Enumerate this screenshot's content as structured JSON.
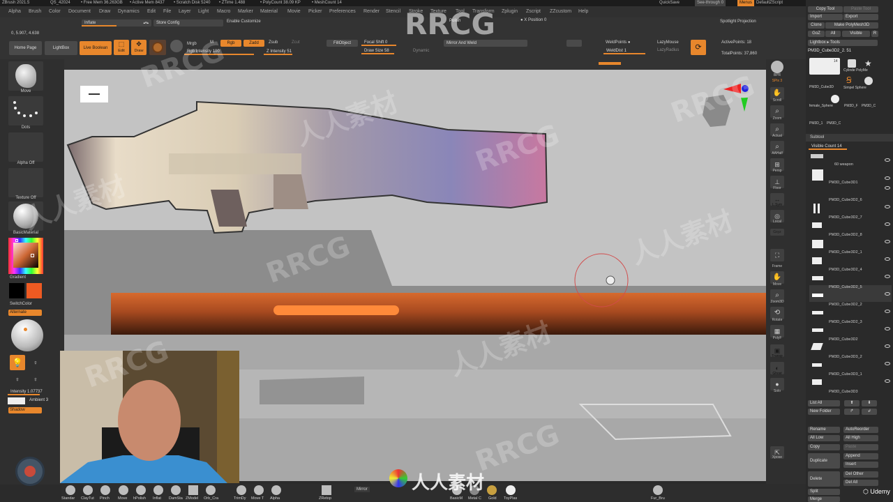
{
  "titlebar": {
    "app": "ZBrush 2021.5",
    "qs": "QS_42024",
    "free_mem": "• Free Mem 36.263GB",
    "active_mem": "• Active Mem 8437",
    "scratch": "• Scratch Disk 5240",
    "ztime": "• ZTime 1.488",
    "polycount": "• PolyCount 38.09 KP",
    "meshcount": "• MeshCount 14",
    "quicksave": "QuickSave",
    "seethrough": "See-through",
    "seethrough_val": "0",
    "menus": "Menus",
    "script": "DefaultZScript"
  },
  "menu": [
    "Alpha",
    "Brush",
    "Color",
    "Document",
    "Draw",
    "Dynamics",
    "Edit",
    "File",
    "Layer",
    "Light",
    "Macro",
    "Marker",
    "Material",
    "Movie",
    "Picker",
    "Preferences",
    "Render",
    "Stencil",
    "Stroke",
    "Texture",
    "Tool",
    "Transform",
    "Zplugin",
    "Zscript",
    "ZZcustom",
    "Help"
  ],
  "topbar": {
    "inflate": "Inflate",
    "store_config": "Store Config",
    "enable_customize": "Enable Customize",
    "coords": "0, 5.907, 4.638",
    "home": "Home Page",
    "lightbox": "LightBox",
    "live_boolean": "Live Boolean",
    "edit": "Edit",
    "draw": "Draw",
    "mrgb": "Mrgb",
    "m": "M",
    "rgb": "Rgb",
    "zadd": "Zadd",
    "zsub": "Zsub",
    "zcut": "Zcut",
    "rgb_intensity": "Rgb Intensity",
    "rgb_intensity_val": "100",
    "z_intensity": "Z Intensity",
    "z_intensity_val": "51",
    "fill_object": "FillObject",
    "focal_shift": "Focal Shift",
    "focal_shift_val": "0",
    "draw_size": "Draw Size",
    "draw_size_val": "58",
    "dynamic": "Dynamic",
    "polish": "Polish",
    "x_position": "X Position",
    "x_position_val": "0",
    "mirror_and_weld": "Mirror And Weld",
    "weld_points": "WeldPoints",
    "weld_dist": "WeldDist",
    "weld_dist_val": "1",
    "lazymouse": "LazyMouse",
    "lazyradius": "LazyRadius",
    "spotlight": "Spotlight Projection",
    "active_points": "ActivePoints: 18",
    "total_points": "TotalPoints: 37,860"
  },
  "leftshelf": {
    "move": "Move",
    "dots": "Dots",
    "alpha_off": "Alpha Off",
    "texture_off": "Texture Off",
    "basic_material": "BasicMaterial",
    "gradient": "Gradient",
    "switch_color": "SwitchColor",
    "alternate": "Alternate",
    "intensity": "Intensity",
    "intensity_val": "1.07737",
    "ambient": "Ambient",
    "ambient_val": "3",
    "shadow": "Shadow"
  },
  "rightshelf": [
    "BPR",
    "SPix 3",
    "Scroll",
    "Zoom",
    "Actual",
    "AAHalf",
    "Persp",
    "Floor",
    "L.Sym",
    "Local",
    "Gxyz",
    "Frame",
    "Move",
    "Zoom3D",
    "Rotate",
    "PolyF",
    "Transp",
    "Ghost",
    "Solo",
    "Xpose"
  ],
  "rpanel": {
    "copy_tool": "Copy Tool",
    "paste_tool": "Paste Tool",
    "import": "Import",
    "export": "Export",
    "clone": "Clone",
    "make_polymesh": "Make PolyMesh3D",
    "goz": "GoZ",
    "all": "All",
    "visible": "Visible",
    "r": "R",
    "lightbox_tools": "Lightbox ▸ Tools",
    "current_tool": "PM3D_Cube3D2_2. 51",
    "tool_thumbs": [
      "PM3D_Cube3D",
      "Cylinde PolyMe",
      "SimpleBrush",
      "Simpel Sphere",
      "female_Sphere",
      "PM3D_F",
      "PM3D_C",
      "PM3D_1",
      "PM3D_C"
    ],
    "subtool": "Subtool",
    "visible_count": "Visible Count",
    "visible_count_val": "14",
    "subtools": [
      "60 weapon",
      "PM3D_Cube3D1",
      "PM3D_Cube3D2_6",
      "PM3D_Cube3D2_7",
      "PM3D_Cube3D2_8",
      "PM3D_Cube3D2_1",
      "PM3D_Cube3D2_4",
      "PM3D_Cube3D2_5",
      "PM3D_Cube3D2_2",
      "PM3D_Cube3D2_3",
      "PM3D_Cube3D2",
      "PM3D_Cube3D3_2",
      "PM3D_Cube3D3_1",
      "PM3D_Cube3D3"
    ],
    "list_all": "List All",
    "new_folder": "New Folder",
    "rename": "Rename",
    "auto_reorder": "AutoReorder",
    "all_low": "All Low",
    "all_high": "All High",
    "copy": "Copy",
    "paste": "Paste",
    "duplicate": "Duplicate",
    "append": "Append",
    "insert": "Insert",
    "delete": "Delete",
    "del_other": "Del Other",
    "del_all": "Del All",
    "split": "Split",
    "merge": "Merge",
    "udemy": "Udemy"
  },
  "bottom": [
    "Standar",
    "ClayTut",
    "Pinch",
    "Move",
    "hPolish",
    "Inflat",
    "DamSta",
    "ZModel",
    "Orb_Cra",
    "TrimDy",
    "Move T",
    "Alpha",
    "ZRetop",
    "Mirror",
    "BasicM",
    "Metal C",
    "Gold",
    "ToyPlas",
    "Fur_Bru"
  ],
  "watermarks": {
    "main": "RRCG",
    "cn": "人人素材",
    "logo_text": "人人素材"
  }
}
